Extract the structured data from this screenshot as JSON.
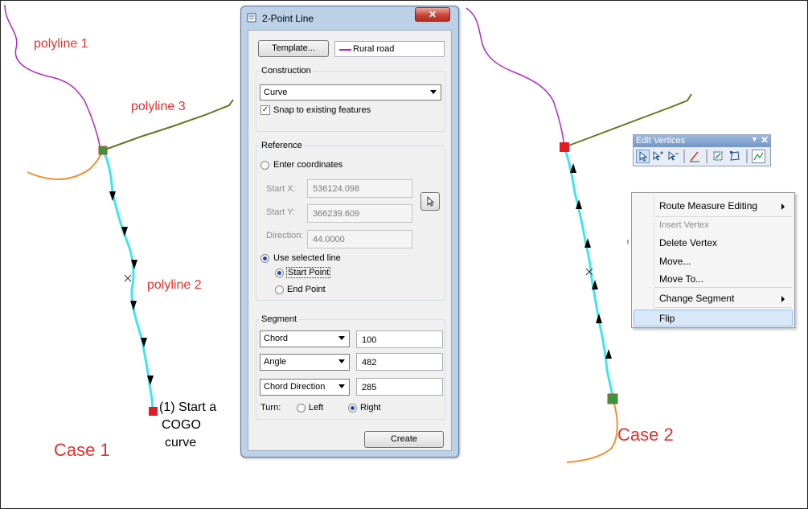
{
  "map": {
    "labels": {
      "polyline1": "polyline 1",
      "polyline3": "polyline 3",
      "polyline2": "polyline 2",
      "start_cogo": [
        "(1) Start a",
        "COGO",
        "curve"
      ],
      "case1": "Case 1",
      "case2": "Case 2"
    },
    "colors": {
      "polyline1": "#b128c8",
      "polyline3": "#5e7b1e",
      "polyline2": "#3de6ef",
      "orange": "#f3902f",
      "label_red": "#e0312c",
      "start_marker": "#e01b24",
      "end_marker": "#2b9d3c"
    }
  },
  "dialog": {
    "title": "2-Point Line",
    "template_button": "Template...",
    "template_value": "Rural road",
    "template_swatch_color": "#b128c8",
    "construction": {
      "label": "Construction",
      "type_value": "Curve",
      "snap_label": "Snap to existing features",
      "snap_checked": true
    },
    "reference": {
      "label": "Reference",
      "enter_coords_label": "Enter coordinates",
      "start_x_label": "Start X:",
      "start_x_value": "536124.098",
      "start_y_label": "Start Y:",
      "start_y_value": "366239.609",
      "direction_label": "Direction:",
      "direction_value": "44.0000",
      "use_selected_label": "Use selected line",
      "start_point_label": "Start Point",
      "end_point_label": "End Point"
    },
    "segment": {
      "label": "Segment",
      "rows": [
        {
          "type": "Chord",
          "value": "100"
        },
        {
          "type": "Angle",
          "value": "482"
        },
        {
          "type": "Chord Direction",
          "value": "285"
        }
      ],
      "turn_label": "Turn:",
      "left_label": "Left",
      "right_label": "Right"
    },
    "create_button": "Create"
  },
  "edit_vertices": {
    "title": "Edit Vertices",
    "tools": [
      "edit-tool-icon",
      "add-vertex-icon",
      "delete-vertex-icon",
      "sketch-properties-icon",
      "continue-feature-icon",
      "finish-sketch-icon",
      "trace-icon"
    ]
  },
  "context_menu": {
    "items": [
      {
        "label": "Route Measure Editing",
        "submenu": true,
        "enabled": true
      },
      {
        "label": "Insert Vertex",
        "submenu": false,
        "enabled": false
      },
      {
        "label": "Delete Vertex",
        "submenu": false,
        "enabled": true
      },
      {
        "label": "Move...",
        "submenu": false,
        "enabled": true
      },
      {
        "label": "Move To...",
        "submenu": false,
        "enabled": true
      },
      {
        "label": "Change Segment",
        "submenu": true,
        "enabled": true
      },
      {
        "label": "Flip",
        "submenu": false,
        "enabled": true,
        "highlighted": true
      }
    ]
  }
}
